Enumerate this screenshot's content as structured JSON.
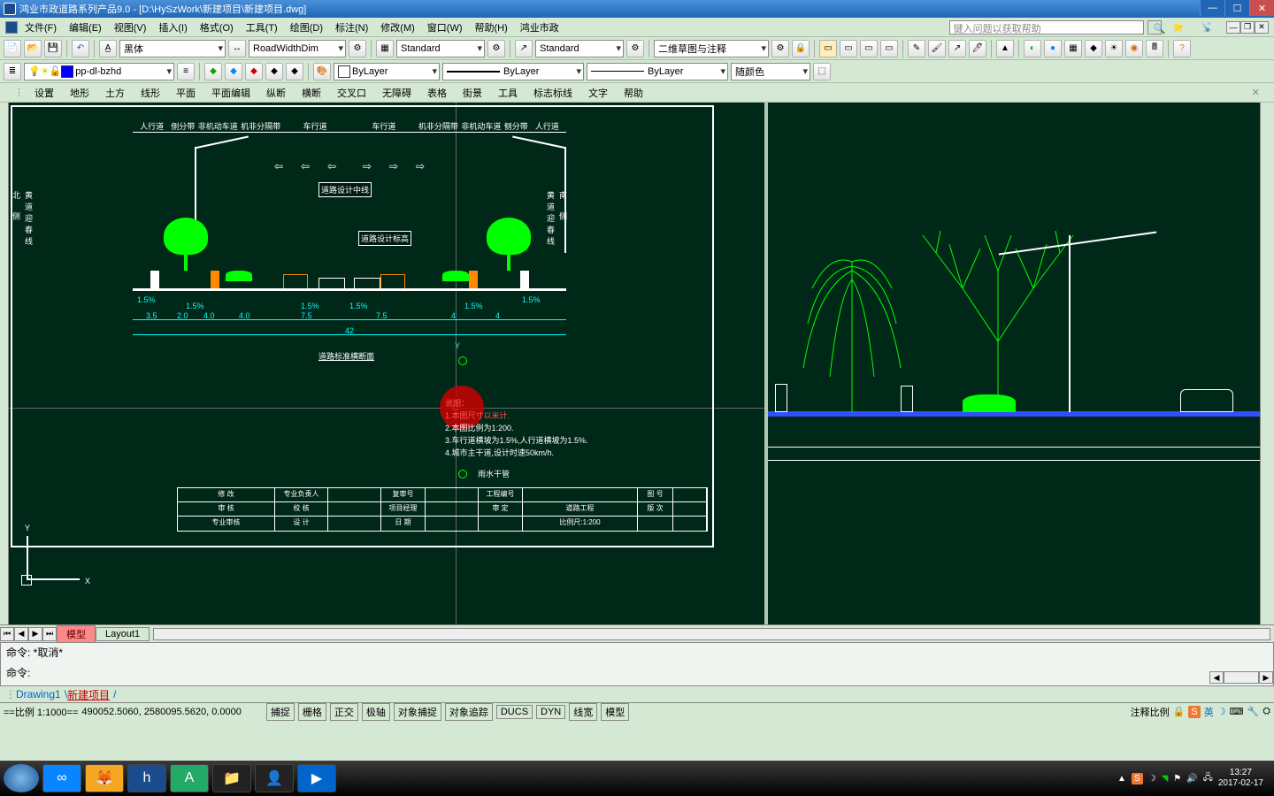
{
  "title": "鸿业市政道路系列产品9.0  - [D:\\HySzWork\\新建项目\\新建项目.dwg]",
  "menu": [
    "文件(F)",
    "编辑(E)",
    "视图(V)",
    "插入(I)",
    "格式(O)",
    "工具(T)",
    "绘图(D)",
    "标注(N)",
    "修改(M)",
    "窗口(W)",
    "帮助(H)",
    "鸿业市政"
  ],
  "help_placeholder": "键入问题以获取帮助",
  "toolbar1": {
    "font": "黑体",
    "dimstyle": "RoadWidthDim",
    "tablestyle": "Standard",
    "textstyle": "Standard",
    "workspace": "二维草图与注释"
  },
  "toolbar2": {
    "layer": "pp-dl-bzhd",
    "color": "ByLayer",
    "linetype": "ByLayer",
    "lineweight": "ByLayer",
    "plotcolor": "随颜色"
  },
  "submenu": [
    "设置",
    "地形",
    "土方",
    "线形",
    "平面",
    "平面编辑",
    "纵断",
    "横断",
    "交叉口",
    "无障碍",
    "表格",
    "街景",
    "工具",
    "标志标线",
    "文字",
    "帮助"
  ],
  "section": {
    "lanes": [
      "人行道",
      "侧分带",
      "非机动车道",
      "机非分隔带",
      "车行道",
      "车行道",
      "机非分隔带",
      "非机动车道",
      "侧分带",
      "人行道"
    ],
    "dims_bottom1": [
      "3.5",
      "2.0",
      "4.0",
      "4.0",
      "7.5",
      "7.5",
      "4",
      "4"
    ],
    "dims_slopes": [
      "1.5%",
      "1.5%",
      "1.5%",
      "1.5%",
      "1.5%",
      "1.5%"
    ],
    "total": "42",
    "centerline": "道路设计中线",
    "level": "道路设计标高",
    "title": "道路标准横断面",
    "left_label": "北 侧",
    "right_label": "南 侧",
    "side_text": "黄道迎春线"
  },
  "notes": {
    "header": "说明：",
    "n1": "1.本图尺寸以米计.",
    "n2": "2.本图比例为1:200.",
    "n3": "3.车行道横坡为1.5%,人行道横坡为1.5%.",
    "n4": "4.城市主干道,设计时速50km/h.",
    "rain": "雨水干管"
  },
  "title_block": {
    "r1": [
      "修 改",
      "专业负责人",
      "复审号",
      "工程编号",
      "图 号"
    ],
    "r2": [
      "审 核",
      "校 核",
      "项目经理",
      "审 定",
      "道路工程",
      "版 次"
    ],
    "r3": [
      "专业审核",
      "设 计",
      "日 期",
      "比例尺:1:200"
    ]
  },
  "ucs": {
    "x": "X",
    "y": "Y"
  },
  "layout_tabs": {
    "model": "模型",
    "layout1": "Layout1"
  },
  "cmd": {
    "cancel": "命令: *取消*",
    "prompt": "命令:"
  },
  "docs": {
    "d1": "Drawing1",
    "d2": "新建项目"
  },
  "status": {
    "scale": "==比例 1:1000==",
    "coord": "490052.5060, 2580095.5620, 0.0000",
    "toggles": [
      "捕捉",
      "栅格",
      "正交",
      "极轴",
      "对象捕捉",
      "对象追踪",
      "DUCS",
      "DYN",
      "线宽",
      "模型"
    ],
    "anno_scale": "注释比例"
  },
  "clock": {
    "time": "13:27",
    "date": "2017-02-17"
  },
  "tray_ime": "英"
}
